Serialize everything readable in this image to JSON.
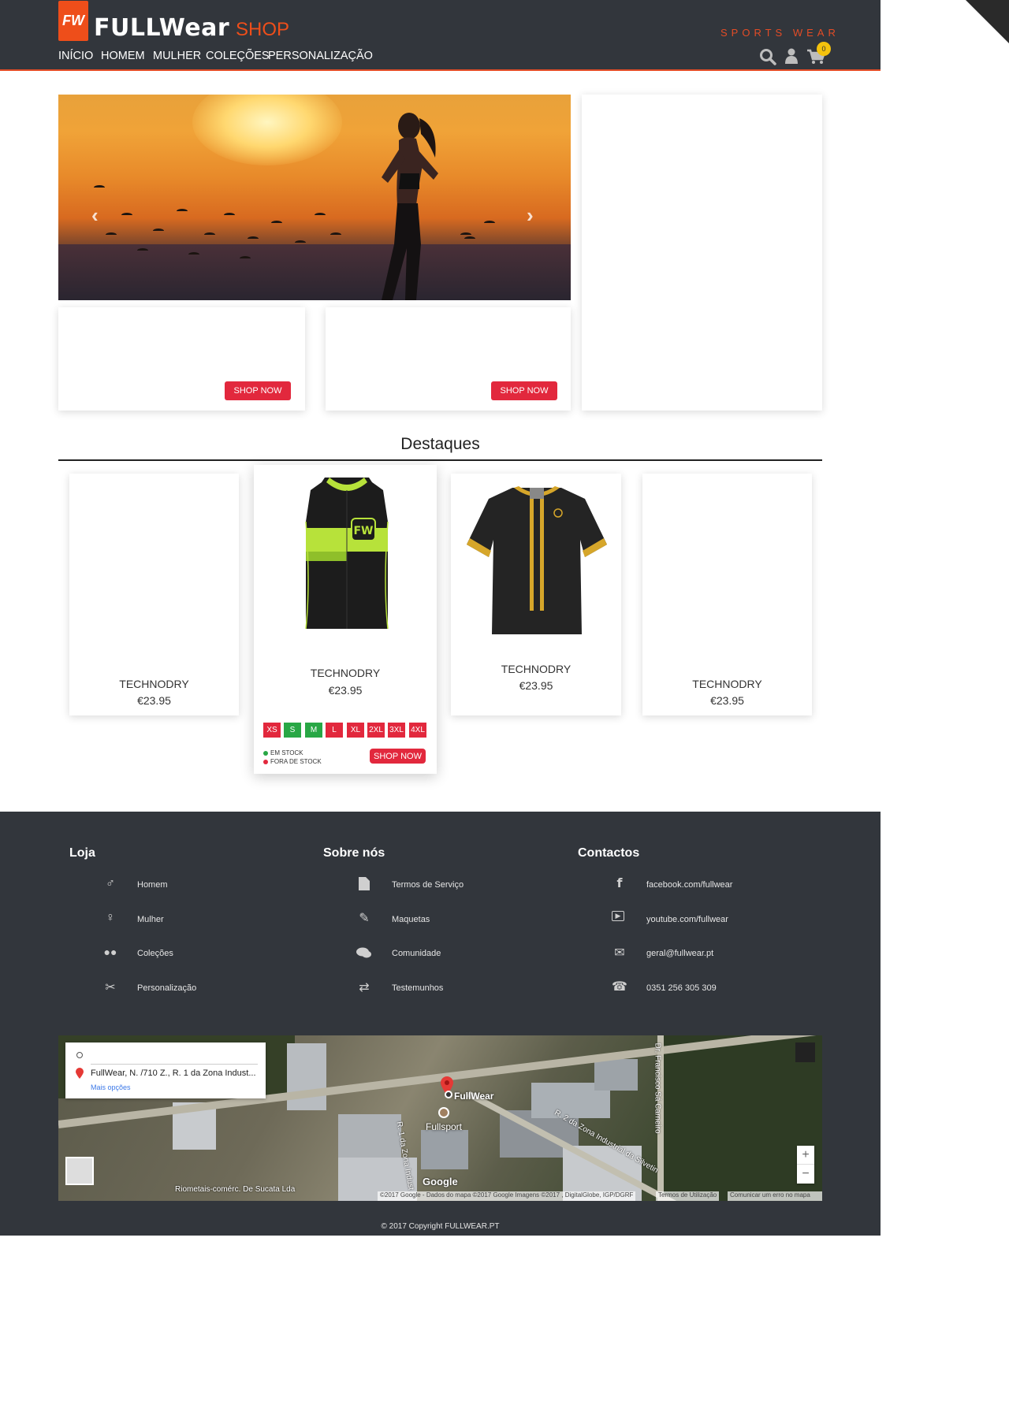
{
  "header": {
    "logo_mark": "FW",
    "logo_text": "FULLWear",
    "logo_shop": "SHOP",
    "tagline": "SPORTS WEAR",
    "nav": [
      "INÍCIO",
      "HOMEM",
      "MULHER",
      "COLEÇÕES",
      "PERSONALIZAÇÃO"
    ],
    "cart_count": "0"
  },
  "promo": {
    "shop_now": "SHOP NOW"
  },
  "featured": {
    "title": "Destaques",
    "products": [
      {
        "name": "TECHNODRY",
        "price": "€23.95"
      },
      {
        "name": "TECHNODRY",
        "price": "€23.95"
      },
      {
        "name": "TECHNODRY",
        "price": "€23.95"
      },
      {
        "name": "TECHNODRY",
        "price": "€23.95"
      }
    ],
    "sizes": [
      {
        "label": "XS",
        "color": "#e2283d"
      },
      {
        "label": "S",
        "color": "#28a745"
      },
      {
        "label": "M",
        "color": "#28a745"
      },
      {
        "label": "L",
        "color": "#e2283d"
      },
      {
        "label": "XL",
        "color": "#e2283d"
      },
      {
        "label": "2XL",
        "color": "#e2283d"
      },
      {
        "label": "3XL",
        "color": "#e2283d"
      },
      {
        "label": "4XL",
        "color": "#e2283d"
      }
    ],
    "in_stock": "EM STOCK",
    "out_of_stock": "FORA DE STOCK",
    "shop_now": "SHOP NOW"
  },
  "footer": {
    "loja": {
      "title": "Loja",
      "links": [
        "Homem",
        "Mulher",
        "Coleções",
        "Personalização"
      ]
    },
    "sobre": {
      "title": "Sobre nós",
      "links": [
        "Termos de Serviço",
        "Maquetas",
        "Comunidade",
        "Testemunhos"
      ]
    },
    "contactos": {
      "title": "Contactos",
      "links": [
        "facebook.com/fullwear",
        "youtube.com/fullwear",
        "geral@fullwear.pt",
        "0351 256 305 309"
      ]
    },
    "copyright": "© 2017 Copyright FULLWEAR.PT"
  },
  "map": {
    "address": "FullWear, N. /710 Z., R. 1 da Zona Indust...",
    "more_options": "Mais opções",
    "pin_label": "FullWear",
    "place_label": "Fullsport",
    "road1": "R. 1 da Zona Indust",
    "road2": "R. 2 da Zona Industrial da Silvetin",
    "road3": "Dr. Francisco Sá Carneiro",
    "place2": "Riometais-comérc. De Sucata Lda",
    "attribution": "©2017 Google - Dados do mapa ©2017 Google Imagens ©2017 , DigitalGlobe, IGP/DGRF",
    "terms": "Termos de Utilização",
    "report": "Comunicar um erro no mapa",
    "google": "Google",
    "zoom_in": "+",
    "zoom_out": "−"
  }
}
